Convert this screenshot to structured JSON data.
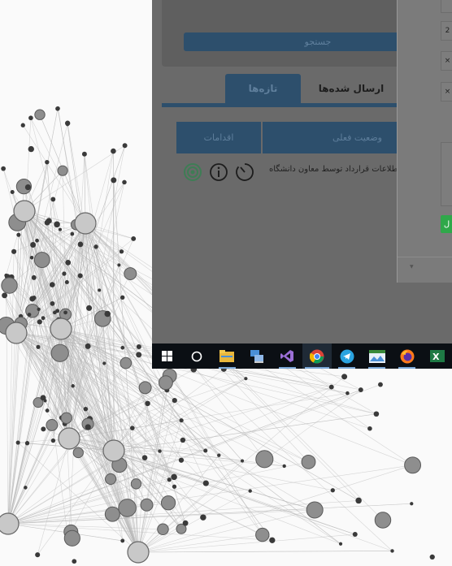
{
  "main": {
    "search_button_label": "جستجو",
    "tabs": [
      {
        "label": "تازه‌ها",
        "active": true
      },
      {
        "label": "ارسال شده‌ها",
        "active": false
      }
    ],
    "table": {
      "columns": [
        "اقدامات",
        "وضعیت فعلی"
      ],
      "rows": [
        {
          "status": "اطلاعات قرارداد توسط معاون دانشگاه"
        }
      ]
    }
  },
  "dialog": {
    "field_values": [
      "",
      "2",
      "×",
      "×"
    ],
    "submit_label": "ل"
  },
  "taskbar": {
    "items": [
      "windows-start-icon",
      "search-circle-icon",
      "file-explorer-icon",
      "network-icon",
      "visual-studio-icon",
      "chrome-icon",
      "telegram-icon",
      "photos-icon",
      "firefox-icon",
      "excel-icon"
    ]
  },
  "colors": {
    "accent": "#2d4f6c",
    "overlay": "#6a6a6a",
    "green": "#2fa84a",
    "taskbar": "#0b0f14"
  }
}
